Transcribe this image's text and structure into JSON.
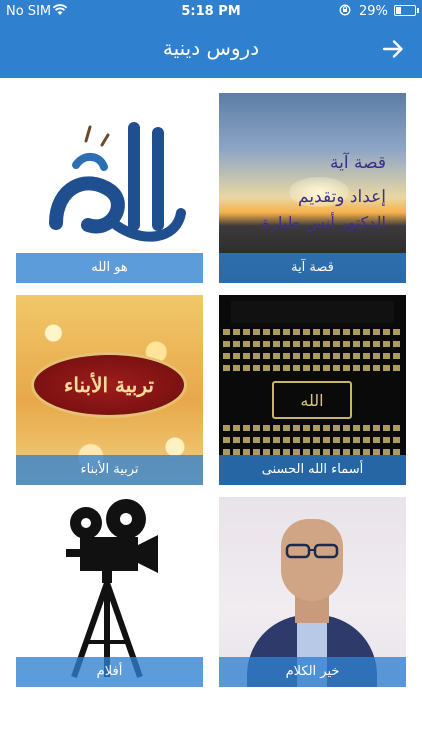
{
  "status_bar": {
    "carrier": "No SIM",
    "time": "5:18 PM",
    "battery_percent": "29%",
    "battery_level": 0.29
  },
  "header": {
    "title": "دروس دينية",
    "background": "#2f80cf"
  },
  "tiles": [
    {
      "caption": "قصة آية",
      "image_lines": [
        "قصة آية",
        "إعداد وتقديم",
        "الدكتور أنس طبارة"
      ]
    },
    {
      "caption": "هو الله"
    },
    {
      "caption": "أسماء الله الحسنى",
      "image_center": "الله"
    },
    {
      "caption": "تربية الأبناء",
      "image_banner": "تربية الأبناء"
    },
    {
      "caption": "خير الكلام"
    },
    {
      "caption": "أفلام"
    }
  ]
}
